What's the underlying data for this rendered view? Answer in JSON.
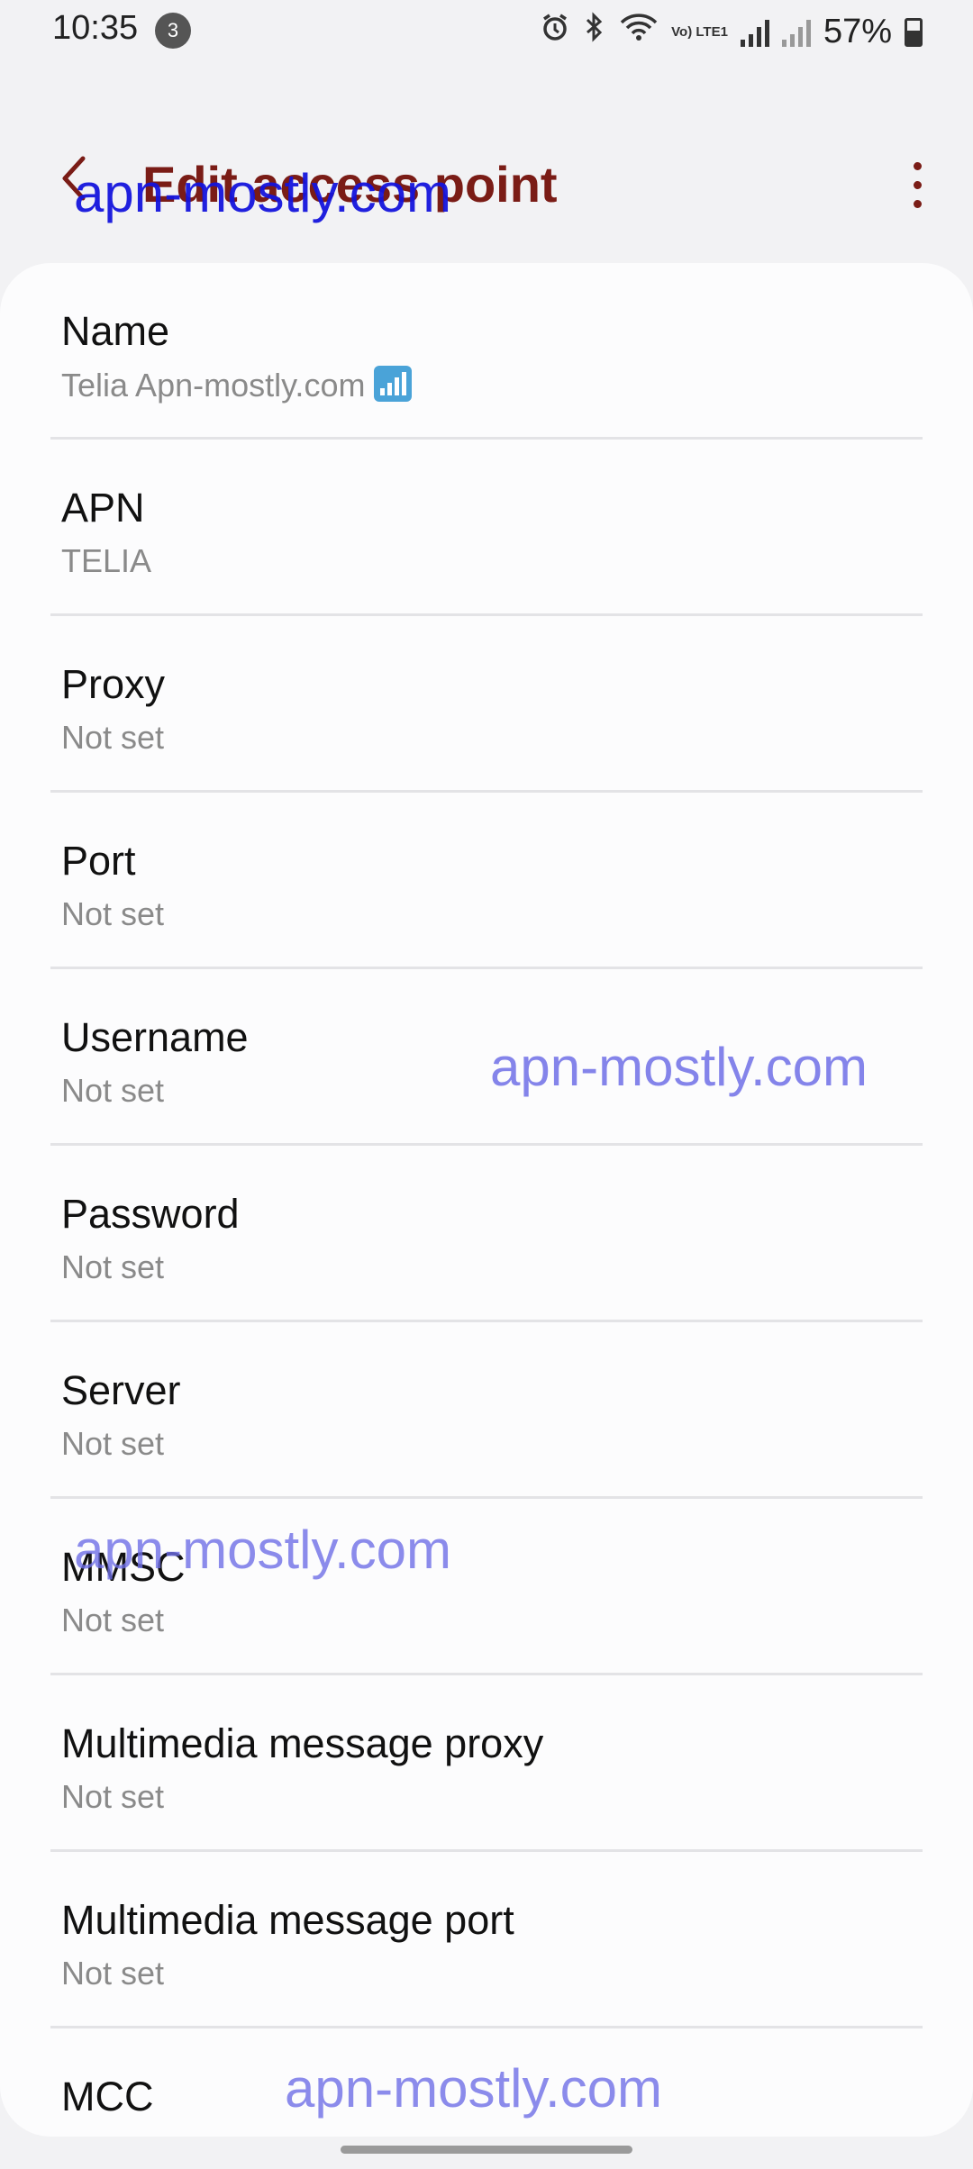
{
  "status_bar": {
    "time": "10:35",
    "notification_count": "3",
    "volte_label": "Vo) LTE1",
    "battery_percent": "57%",
    "icons": [
      "alarm-icon",
      "bluetooth-icon",
      "wifi-icon",
      "volte-icon",
      "signal-icon",
      "signal-icon",
      "battery-icon"
    ]
  },
  "header": {
    "title": "Edit access point",
    "back_icon": "chevron-left-icon",
    "more_icon": "more-vertical-icon"
  },
  "fields": [
    {
      "label": "Name",
      "value": "Telia Apn-mostly.com"
    },
    {
      "label": "APN",
      "value": "TELIA"
    },
    {
      "label": "Proxy",
      "value": "Not set"
    },
    {
      "label": "Port",
      "value": "Not set"
    },
    {
      "label": "Username",
      "value": "Not set"
    },
    {
      "label": "Password",
      "value": "Not set"
    },
    {
      "label": "Server",
      "value": "Not set"
    },
    {
      "label": "MMSC",
      "value": "Not set"
    },
    {
      "label": "Multimedia message proxy",
      "value": "Not set"
    },
    {
      "label": "Multimedia message port",
      "value": "Not set"
    },
    {
      "label": "MCC",
      "value": ""
    }
  ],
  "watermarks": [
    "apn-mostly.com",
    "apn-mostly.com",
    "apn-mostly.com",
    "apn-mostly.com"
  ],
  "colors": {
    "accent": "#7a1c16",
    "background": "#f2f2f4",
    "card": "#fcfcfd",
    "secondary_text": "#8a8a8a"
  }
}
